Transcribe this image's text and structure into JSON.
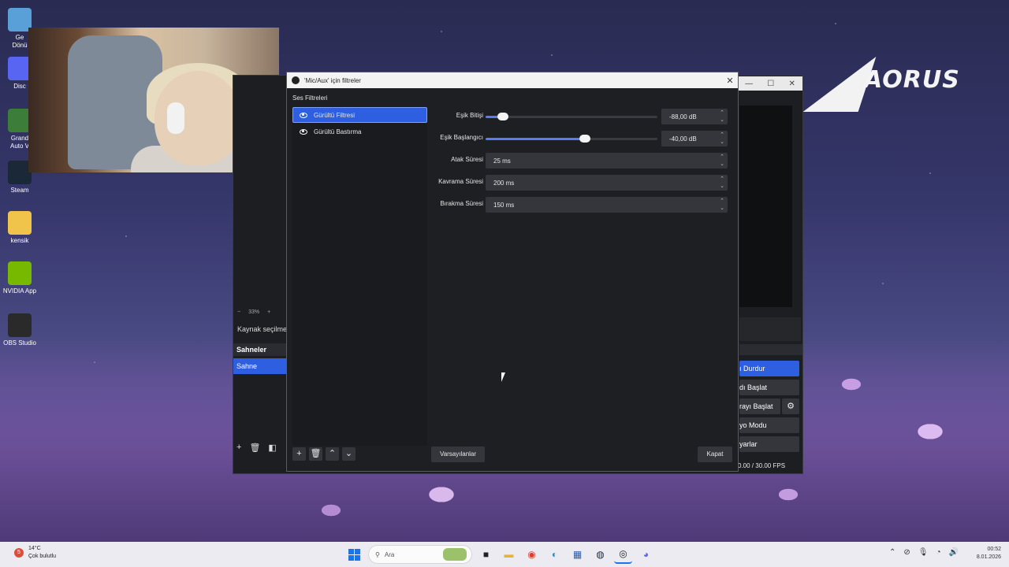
{
  "desktop": {
    "icons": [
      {
        "label": "Ge\nDönü",
        "icon": "recycle-bin-icon",
        "color": "#5aa0d8"
      },
      {
        "label": "Disc",
        "icon": "discord-icon",
        "color": "#5865f2"
      },
      {
        "label": "Grand\nAuto V",
        "icon": "gta-icon",
        "color": "#3d7d3a"
      },
      {
        "label": "Steam",
        "icon": "steam-icon",
        "color": "#1b2838"
      },
      {
        "label": "kensik",
        "icon": "folder-icon",
        "color": "#f0c44a"
      },
      {
        "label": "NVIDIA App",
        "icon": "nvidia-icon",
        "color": "#76b900"
      },
      {
        "label": "OBS Studio",
        "icon": "obs-icon",
        "color": "#2a2a2a"
      }
    ],
    "brand_logo": "AORUS"
  },
  "obs_main": {
    "zoom_label": "33%",
    "source_hint": "Kaynak seçilme",
    "scenes_header": "Sahneler",
    "scenes": [
      "Sahne"
    ],
    "controls": [
      "ı Durdur",
      "dı Başlat",
      "rayı Başlat",
      "yo Modu",
      "yarlar"
    ],
    "fps_text": "0.00 / 30.00 FPS"
  },
  "dialog": {
    "title": "'Mic/Aux' için filtreler",
    "section_label": "Ses Filtreleri",
    "filters": [
      {
        "name": "Gürültü Filtresi",
        "selected": true
      },
      {
        "name": "Gürültü Bastırma",
        "selected": false
      }
    ],
    "properties": [
      {
        "label": "Eşik Bitişi",
        "type": "slider",
        "value": "-88,00 dB",
        "fraction": 0.1
      },
      {
        "label": "Eşik Başlangıcı",
        "type": "slider",
        "value": "-40,00 dB",
        "fraction": 0.58
      },
      {
        "label": "Atak Süresi",
        "type": "spin",
        "value": "25 ms"
      },
      {
        "label": "Kavrama Süresi",
        "type": "spin",
        "value": "200 ms"
      },
      {
        "label": "Bırakma Süresi",
        "type": "spin",
        "value": "150 ms"
      }
    ],
    "defaults_label": "Varsayılanlar",
    "close_label": "Kapat"
  },
  "taskbar": {
    "weather_temp": "14°C",
    "weather_desc": "Çok bulutlu",
    "weather_badge": "5",
    "search_placeholder": "Ara",
    "time": "00:52",
    "date": "8.01.2026"
  },
  "colors": {
    "accent": "#2e5fe0",
    "dialog_bg": "#1e1f23"
  }
}
